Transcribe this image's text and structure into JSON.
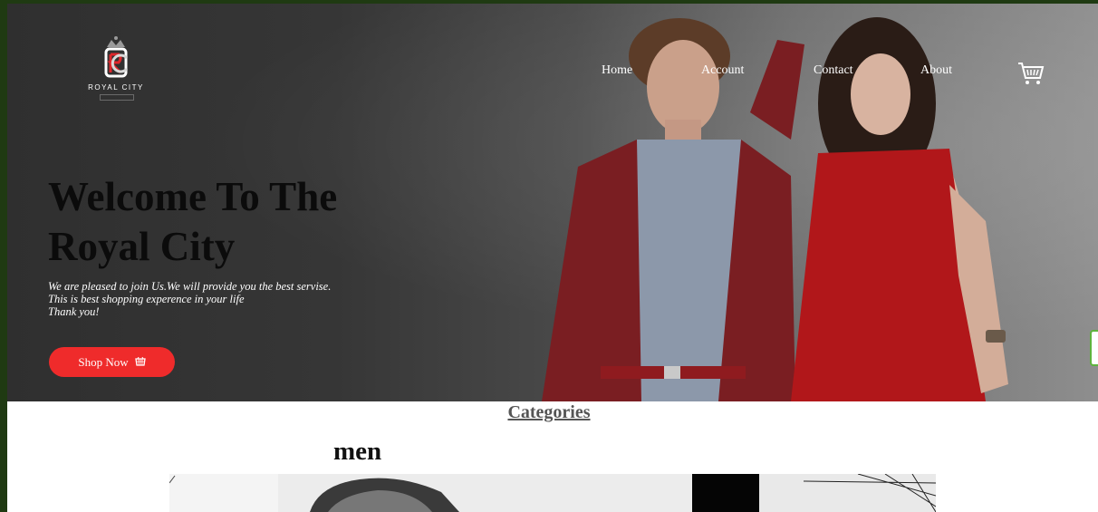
{
  "brand": {
    "logo_text": "ROYAL CITY"
  },
  "nav": {
    "items": [
      "Home",
      "Account",
      "Contact",
      "About"
    ]
  },
  "hero": {
    "title_line1": "Welcome To The",
    "title_line2": "Royal City",
    "text_lines": [
      "We are pleased to join Us.We will provide you the best servise.",
      "This is best shopping experence in your life",
      "Thank you!"
    ],
    "button_label": "Shop Now"
  },
  "categories": {
    "heading": "Categories",
    "items": [
      {
        "title": "men"
      }
    ]
  },
  "colors": {
    "accent": "#ef2b2b",
    "nav_text": "#ffffff",
    "hero_bg": "#333333",
    "heading": "#555555"
  },
  "icons": [
    "crown-logo-icon",
    "shopping-cart-icon",
    "basket-icon"
  ]
}
